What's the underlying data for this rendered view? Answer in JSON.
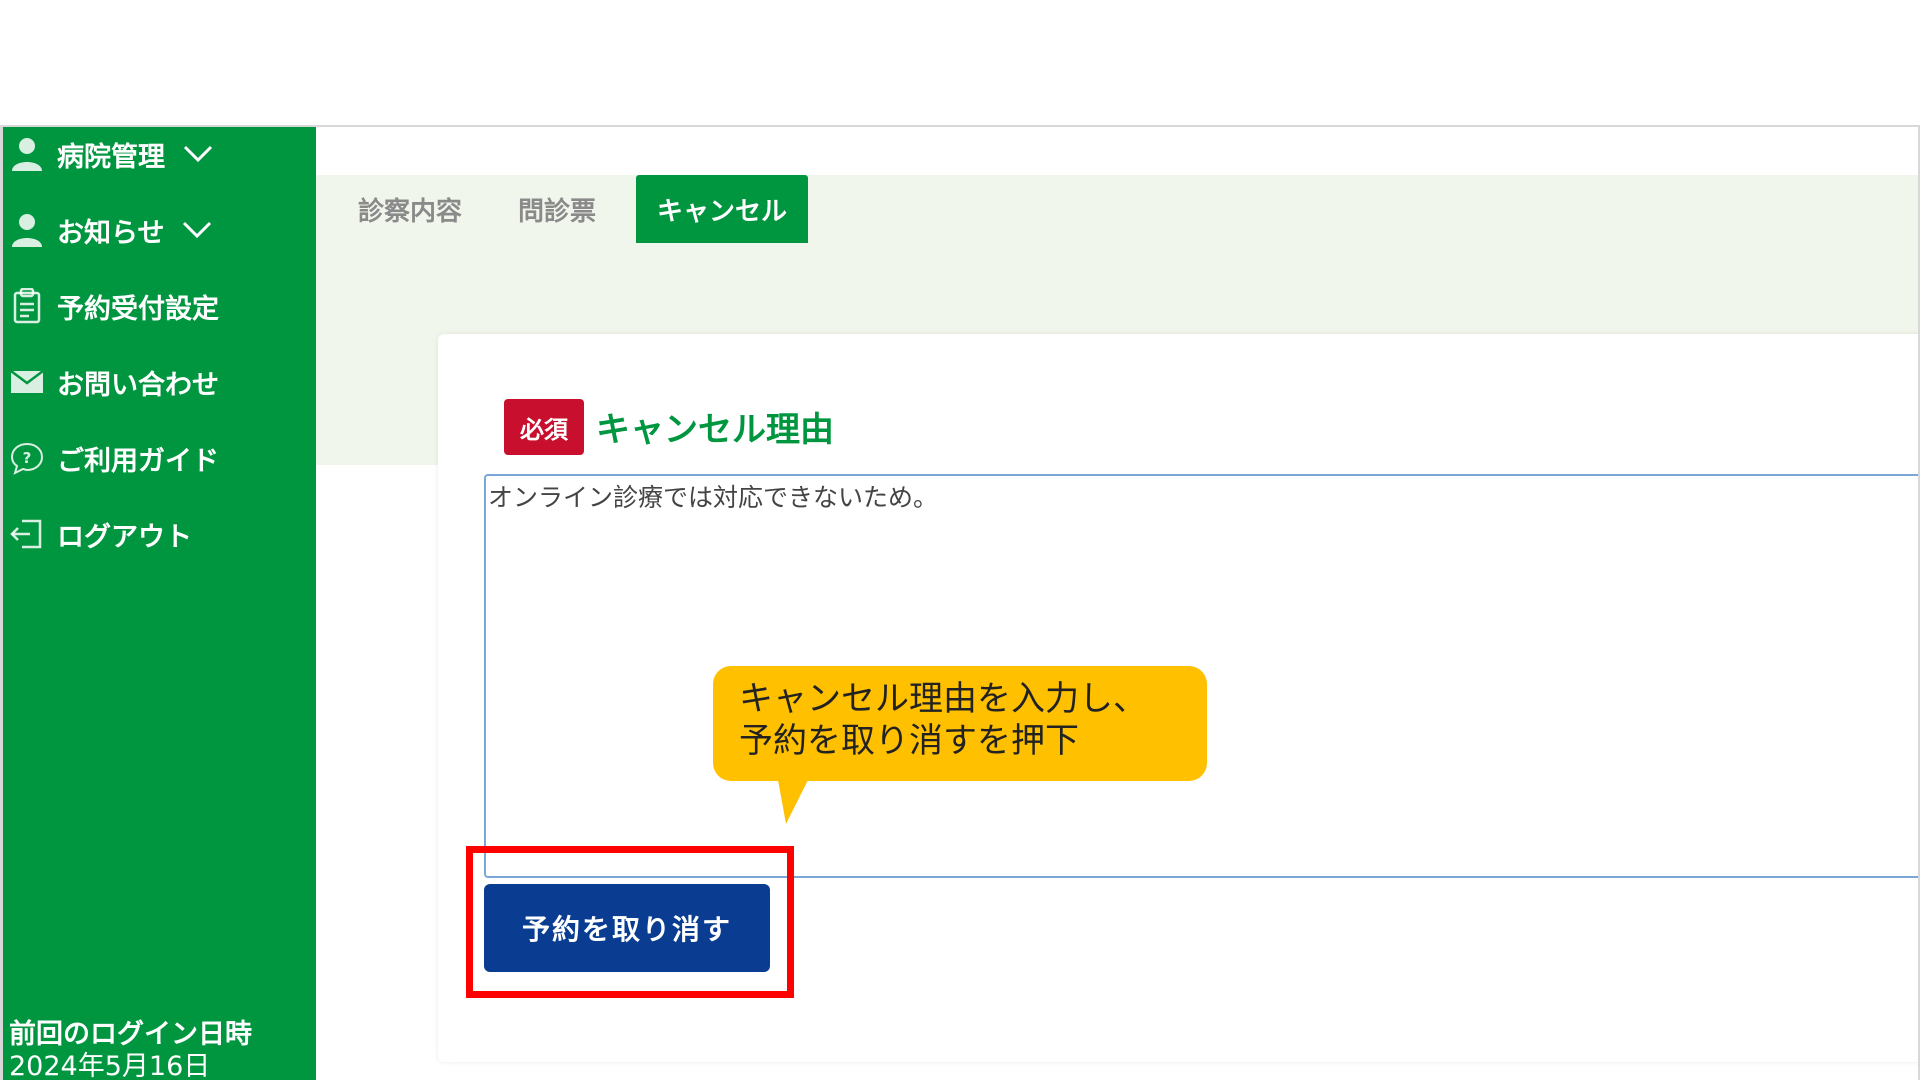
{
  "sidebar": {
    "items": [
      {
        "label": "病院管理",
        "icon": "user-icon",
        "has_chevron": true
      },
      {
        "label": "お知らせ",
        "icon": "user-icon",
        "has_chevron": true
      },
      {
        "label": "予約受付設定",
        "icon": "clipboard-icon",
        "has_chevron": false
      },
      {
        "label": "お問い合わせ",
        "icon": "mail-icon",
        "has_chevron": false
      },
      {
        "label": "ご利用ガイド",
        "icon": "help-bubble-icon",
        "has_chevron": false
      },
      {
        "label": "ログアウト",
        "icon": "logout-icon",
        "has_chevron": false
      }
    ],
    "last_login_label": "前回のログイン日時",
    "last_login_date": "2024年5月16日"
  },
  "tabs": [
    {
      "label": "診察内容",
      "active": false
    },
    {
      "label": "問診票",
      "active": false
    },
    {
      "label": "キャンセル",
      "active": true
    }
  ],
  "form": {
    "required_badge": "必須",
    "section_title": "キャンセル理由",
    "reason_value": "オンライン診療では対応できないため。",
    "submit_label": "予約を取り消す"
  },
  "annotation": {
    "callout_line1": "キャンセル理由を入力し、",
    "callout_line2": "予約を取り消すを押下"
  },
  "colors": {
    "brand_green": "#009640",
    "tab_bg": "#f1f6ec",
    "required_red": "#c8102e",
    "button_blue": "#0a3d91",
    "callout_yellow": "#ffc000",
    "highlight_red": "#ff0000"
  }
}
